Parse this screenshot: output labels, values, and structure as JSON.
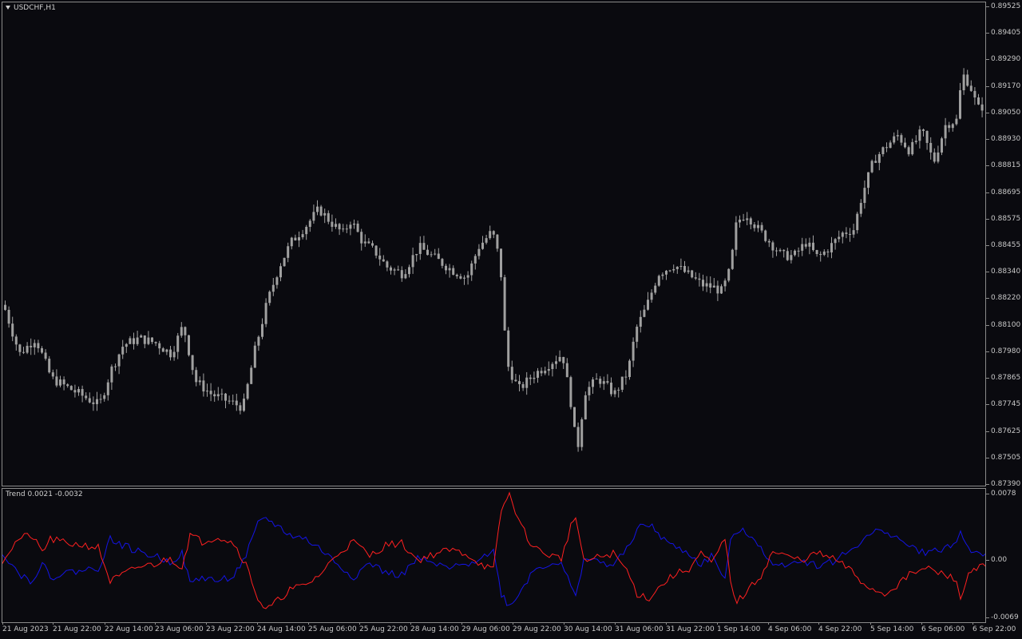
{
  "window": {
    "title": "USDCHF,H1"
  },
  "indicator": {
    "label": "Trend",
    "values": [
      "0.0021",
      "-0.0032"
    ],
    "colors": {
      "red_line": "#ff2020",
      "blue_line": "#1414e6"
    }
  },
  "colors": {
    "background": "#0a0a0f",
    "grid_border": "#8a8a8a",
    "candle": "#a0a0a0",
    "text": "#c8c8c8"
  },
  "price_axis": [
    "0.89525",
    "0.89405",
    "0.89290",
    "0.89170",
    "0.89050",
    "0.88930",
    "0.88815",
    "0.88695",
    "0.88575",
    "0.88455",
    "0.88340",
    "0.88220",
    "0.88100",
    "0.87980",
    "0.87865",
    "0.87745",
    "0.87625",
    "0.87505",
    "0.87390"
  ],
  "indicator_axis": [
    "0.0078",
    "0.00",
    "-0.0069"
  ],
  "time_axis": [
    "21 Aug 2023",
    "21 Aug 22:00",
    "22 Aug 14:00",
    "23 Aug 06:00",
    "23 Aug 22:00",
    "24 Aug 14:00",
    "25 Aug 06:00",
    "25 Aug 22:00",
    "28 Aug 14:00",
    "29 Aug 06:00",
    "29 Aug 22:00",
    "30 Aug 14:00",
    "31 Aug 06:00",
    "31 Aug 22:00",
    "1 Sep 14:00",
    "4 Sep 06:00",
    "4 Sep 22:00",
    "5 Sep 14:00",
    "6 Sep 06:00",
    "6 Sep 22:00"
  ],
  "chart_data": {
    "type": "candlestick",
    "symbol": "USDCHF",
    "timeframe": "H1",
    "ylim": [
      0.8739,
      0.89525
    ],
    "close_path": [
      [
        0,
        0.8819
      ],
      [
        20,
        0.8797
      ],
      [
        40,
        0.8804
      ],
      [
        60,
        0.8786
      ],
      [
        80,
        0.8782
      ],
      [
        100,
        0.8778
      ],
      [
        120,
        0.8774
      ],
      [
        135,
        0.879
      ],
      [
        150,
        0.8801
      ],
      [
        170,
        0.8804
      ],
      [
        190,
        0.8802
      ],
      [
        210,
        0.8797
      ],
      [
        225,
        0.881
      ],
      [
        240,
        0.8785
      ],
      [
        260,
        0.8779
      ],
      [
        280,
        0.8776
      ],
      [
        300,
        0.8773
      ],
      [
        315,
        0.8799
      ],
      [
        330,
        0.882
      ],
      [
        345,
        0.8836
      ],
      [
        360,
        0.8847
      ],
      [
        380,
        0.8855
      ],
      [
        395,
        0.8862
      ],
      [
        410,
        0.8856
      ],
      [
        425,
        0.8851
      ],
      [
        435,
        0.8857
      ],
      [
        450,
        0.8847
      ],
      [
        465,
        0.8843
      ],
      [
        480,
        0.8836
      ],
      [
        500,
        0.8833
      ],
      [
        520,
        0.8845
      ],
      [
        540,
        0.884
      ],
      [
        560,
        0.8835
      ],
      [
        580,
        0.8831
      ],
      [
        595,
        0.8845
      ],
      [
        612,
        0.8852
      ],
      [
        622,
        0.8838
      ],
      [
        630,
        0.8793
      ],
      [
        645,
        0.8781
      ],
      [
        665,
        0.8788
      ],
      [
        685,
        0.8793
      ],
      [
        700,
        0.8797
      ],
      [
        712,
        0.8772
      ],
      [
        718,
        0.8752
      ],
      [
        728,
        0.878
      ],
      [
        745,
        0.8786
      ],
      [
        765,
        0.8779
      ],
      [
        782,
        0.8789
      ],
      [
        792,
        0.8808
      ],
      [
        805,
        0.8818
      ],
      [
        820,
        0.8833
      ],
      [
        840,
        0.8837
      ],
      [
        860,
        0.8832
      ],
      [
        875,
        0.8828
      ],
      [
        888,
        0.8827
      ],
      [
        900,
        0.8825
      ],
      [
        910,
        0.8835
      ],
      [
        918,
        0.8856
      ],
      [
        930,
        0.886
      ],
      [
        945,
        0.8853
      ],
      [
        960,
        0.8847
      ],
      [
        975,
        0.8841
      ],
      [
        990,
        0.8841
      ],
      [
        1005,
        0.8847
      ],
      [
        1020,
        0.884
      ],
      [
        1035,
        0.8845
      ],
      [
        1050,
        0.8851
      ],
      [
        1065,
        0.8853
      ],
      [
        1075,
        0.8868
      ],
      [
        1090,
        0.8884
      ],
      [
        1105,
        0.889
      ],
      [
        1120,
        0.8895
      ],
      [
        1135,
        0.8888
      ],
      [
        1150,
        0.8897
      ],
      [
        1165,
        0.8883
      ],
      [
        1180,
        0.89
      ],
      [
        1195,
        0.8902
      ],
      [
        1200,
        0.8923
      ],
      [
        1210,
        0.8918
      ],
      [
        1220,
        0.8907
      ],
      [
        1232,
        0.8909
      ]
    ],
    "indicator": {
      "name": "Trend",
      "ylim": [
        -0.0069,
        0.0078
      ],
      "red_path": [
        [
          0,
          0.0
        ],
        [
          20,
          0.0025
        ],
        [
          35,
          0.003
        ],
        [
          50,
          0.001
        ],
        [
          60,
          0.0025
        ],
        [
          80,
          0.002
        ],
        [
          100,
          0.0018
        ],
        [
          120,
          0.0015
        ],
        [
          135,
          -0.0025
        ],
        [
          150,
          -0.0018
        ],
        [
          170,
          -0.0008
        ],
        [
          190,
          -0.0005
        ],
        [
          210,
          0.0002
        ],
        [
          225,
          -0.0008
        ],
        [
          235,
          0.003
        ],
        [
          250,
          0.0022
        ],
        [
          270,
          0.0028
        ],
        [
          290,
          0.002
        ],
        [
          305,
          -0.0005
        ],
        [
          320,
          -0.0045
        ],
        [
          330,
          -0.006
        ],
        [
          345,
          -0.0048
        ],
        [
          360,
          -0.0035
        ],
        [
          380,
          -0.003
        ],
        [
          400,
          -0.0015
        ],
        [
          420,
          0.0008
        ],
        [
          440,
          0.0022
        ],
        [
          460,
          0.0005
        ],
        [
          480,
          0.0018
        ],
        [
          500,
          0.002
        ],
        [
          520,
          0.0
        ],
        [
          540,
          0.0007
        ],
        [
          560,
          0.0012
        ],
        [
          580,
          0.0008
        ],
        [
          600,
          -0.0005
        ],
        [
          615,
          -0.0012
        ],
        [
          625,
          0.006
        ],
        [
          635,
          0.0078
        ],
        [
          650,
          0.004
        ],
        [
          665,
          0.0015
        ],
        [
          685,
          0.0006
        ],
        [
          700,
          0.0002
        ],
        [
          712,
          0.004
        ],
        [
          718,
          0.0052
        ],
        [
          728,
          -0.0002
        ],
        [
          745,
          0.0003
        ],
        [
          765,
          0.0008
        ],
        [
          782,
          -0.0012
        ],
        [
          795,
          -0.004
        ],
        [
          810,
          -0.0045
        ],
        [
          825,
          -0.003
        ],
        [
          840,
          -0.0018
        ],
        [
          860,
          -0.001
        ],
        [
          875,
          0.0008
        ],
        [
          888,
          -0.0005
        ],
        [
          905,
          0.0025
        ],
        [
          912,
          -0.0025
        ],
        [
          920,
          -0.005
        ],
        [
          935,
          -0.0035
        ],
        [
          950,
          -0.0018
        ],
        [
          965,
          0.001
        ],
        [
          980,
          0.0005
        ],
        [
          1000,
          0.0
        ],
        [
          1020,
          0.0008
        ],
        [
          1040,
          0.0002
        ],
        [
          1060,
          -0.001
        ],
        [
          1075,
          -0.0025
        ],
        [
          1090,
          -0.0035
        ],
        [
          1105,
          -0.004
        ],
        [
          1120,
          -0.003
        ],
        [
          1140,
          -0.0015
        ],
        [
          1160,
          -0.001
        ],
        [
          1180,
          -0.0018
        ],
        [
          1195,
          -0.0022
        ],
        [
          1200,
          -0.005
        ],
        [
          1210,
          -0.0015
        ],
        [
          1220,
          -0.0008
        ],
        [
          1232,
          -0.0008
        ]
      ],
      "blue_path": [
        [
          0,
          0.001
        ],
        [
          20,
          -0.0015
        ],
        [
          35,
          -0.0025
        ],
        [
          50,
          -0.0005
        ],
        [
          60,
          -0.002
        ],
        [
          80,
          -0.0015
        ],
        [
          100,
          -0.0012
        ],
        [
          120,
          -0.001
        ],
        [
          135,
          0.0025
        ],
        [
          150,
          0.0018
        ],
        [
          170,
          0.001
        ],
        [
          190,
          0.0005
        ],
        [
          210,
          -0.0002
        ],
        [
          225,
          0.0008
        ],
        [
          235,
          -0.0028
        ],
        [
          250,
          -0.002
        ],
        [
          270,
          -0.0025
        ],
        [
          290,
          -0.0018
        ],
        [
          305,
          0.0005
        ],
        [
          320,
          0.0042
        ],
        [
          330,
          0.005
        ],
        [
          345,
          0.004
        ],
        [
          360,
          0.003
        ],
        [
          380,
          0.0025
        ],
        [
          400,
          0.0012
        ],
        [
          420,
          -0.0005
        ],
        [
          440,
          -0.002
        ],
        [
          460,
          -0.0003
        ],
        [
          480,
          -0.0015
        ],
        [
          500,
          -0.0018
        ],
        [
          520,
          0.0002
        ],
        [
          540,
          -0.0005
        ],
        [
          560,
          -0.001
        ],
        [
          580,
          -0.0006
        ],
        [
          600,
          0.0005
        ],
        [
          615,
          0.001
        ],
        [
          625,
          -0.004
        ],
        [
          635,
          -0.0055
        ],
        [
          650,
          -0.0035
        ],
        [
          665,
          -0.0012
        ],
        [
          685,
          -0.0004
        ],
        [
          700,
          -0.0002
        ],
        [
          712,
          -0.0032
        ],
        [
          718,
          -0.0045
        ],
        [
          728,
          0.0003
        ],
        [
          745,
          -0.0002
        ],
        [
          765,
          -0.0006
        ],
        [
          782,
          0.0012
        ],
        [
          795,
          0.0038
        ],
        [
          810,
          0.0042
        ],
        [
          825,
          0.0028
        ],
        [
          840,
          0.0016
        ],
        [
          860,
          0.0008
        ],
        [
          875,
          -0.0006
        ],
        [
          888,
          0.0005
        ],
        [
          905,
          -0.0022
        ],
        [
          912,
          0.002
        ],
        [
          920,
          0.0035
        ],
        [
          935,
          0.0032
        ],
        [
          950,
          0.0016
        ],
        [
          965,
          -0.0008
        ],
        [
          980,
          -0.0004
        ],
        [
          1000,
          0.0
        ],
        [
          1020,
          -0.0006
        ],
        [
          1040,
          -0.0002
        ],
        [
          1060,
          0.001
        ],
        [
          1075,
          0.0022
        ],
        [
          1090,
          0.0032
        ],
        [
          1105,
          0.0036
        ],
        [
          1120,
          0.0026
        ],
        [
          1140,
          0.0014
        ],
        [
          1160,
          0.0008
        ],
        [
          1180,
          0.0015
        ],
        [
          1195,
          0.002
        ],
        [
          1200,
          0.0034
        ],
        [
          1210,
          0.0014
        ],
        [
          1220,
          0.0008
        ],
        [
          1232,
          0.0008
        ]
      ]
    }
  }
}
